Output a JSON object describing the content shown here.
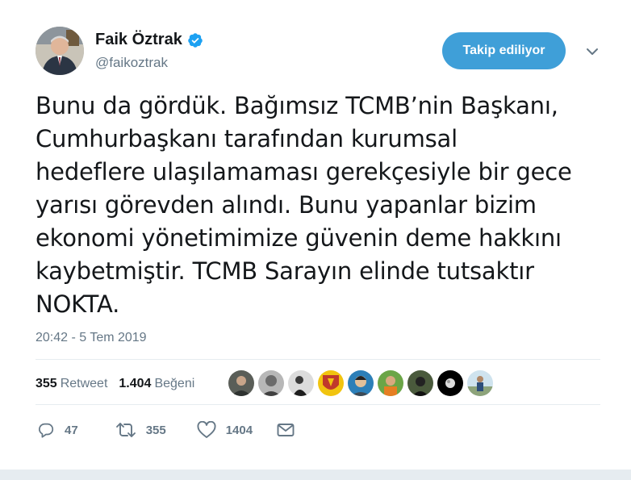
{
  "author": {
    "display_name": "Faik Öztrak",
    "handle": "@faikoztrak",
    "verified": true
  },
  "follow_button": {
    "label": "Takip ediliyor"
  },
  "tweet": {
    "lines": [
      "Bunu da gördük. Bağımsız TCMB’nin Başkanı,",
      "Cumhurbaşkanı tarafından kurumsal",
      "hedeflere ulaşılamaması gerekçesiyle bir gece",
      "yarısı görevden alındı. Bunu yapanlar bizim",
      "ekonomi yönetimimize güvenin deme hakkını",
      "kaybetmiştir. TCMB Sarayın elinde tutsaktır",
      "NOKTA."
    ],
    "timestamp": "20:42 - 5 Tem 2019"
  },
  "stats": {
    "retweets_count": "355",
    "retweets_label": "Retweet",
    "likes_count": "1.404",
    "likes_label": "Beğeni"
  },
  "actions": {
    "reply_count": "47",
    "retweet_count": "355",
    "like_count": "1404"
  },
  "colors": {
    "accent": "#1da1f2",
    "follow_button": "#3f9fd8",
    "secondary_text": "#657786",
    "divider": "#e6ecf0"
  },
  "icons": [
    "verified-badge-icon",
    "chevron-down-icon",
    "reply-icon",
    "retweet-icon",
    "heart-icon",
    "message-icon"
  ]
}
